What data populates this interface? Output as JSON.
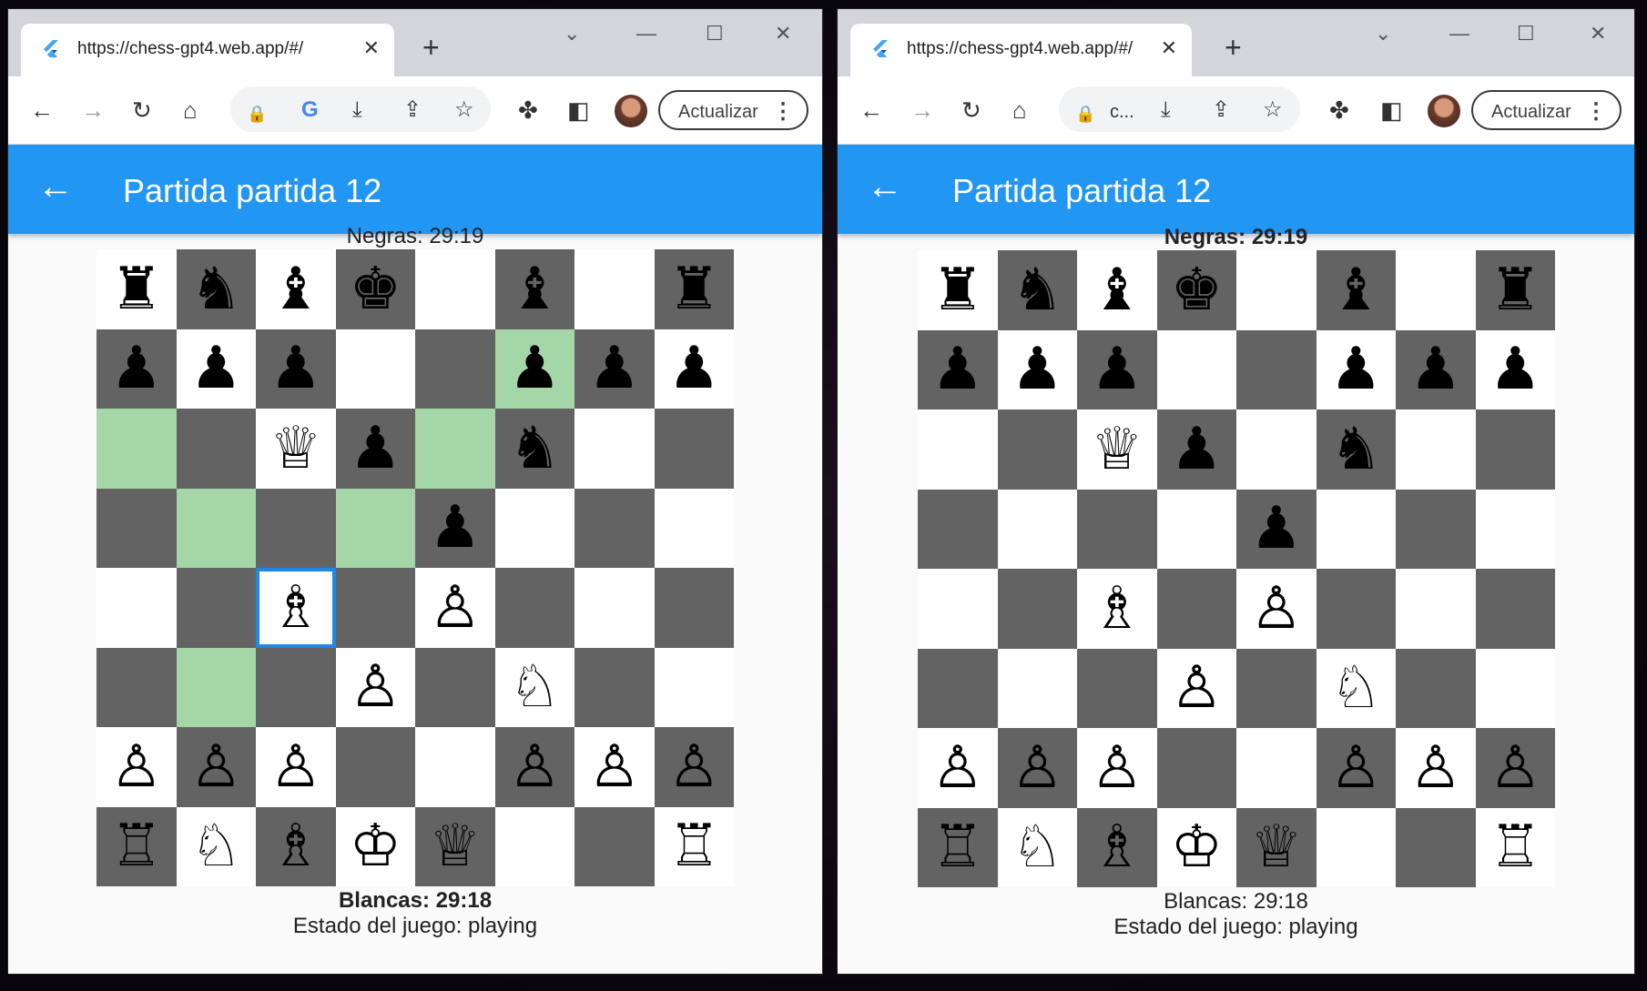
{
  "browser": {
    "tab_title_1": "https://chess-gpt4.web.app/#/",
    "tab_title_2": "https://chess-gpt4.web.app/#/",
    "omnibox_text_2": "c...",
    "update_label": "Actualizar"
  },
  "icons": {
    "back": "←",
    "forward": "→",
    "reload": "↻",
    "home": "⌂",
    "lock": "🔒",
    "close": "✕",
    "newtab": "+",
    "star": "☆",
    "share": "⇪",
    "install": "⤓",
    "extensions": "✤",
    "sidepanel": "◧",
    "menu": "⋮",
    "minimize": "—",
    "maximize": "☐",
    "chevron": "⌄",
    "google": "G"
  },
  "app": {
    "title": "Partida partida 12",
    "back_icon": "←"
  },
  "colors": {
    "appbar": "#2196f3",
    "dark_square": "#636363",
    "light_square": "#ffffff",
    "highlight": "#a5d6a7",
    "selection": "#1e88e5"
  },
  "game_left": {
    "black_clock": "Negras: 29:19",
    "white_clock": "Blancas: 29:18",
    "status": "Estado del juego: playing",
    "active_player": "white",
    "selected_square": [
      4,
      2
    ],
    "highlights": [
      [
        1,
        5
      ],
      [
        2,
        0
      ],
      [
        2,
        4
      ],
      [
        3,
        1
      ],
      [
        3,
        3
      ],
      [
        5,
        1
      ]
    ],
    "board": [
      [
        "♜",
        "♞",
        "♝",
        "♚",
        "",
        "♝",
        "",
        "♜"
      ],
      [
        "♟",
        "♟",
        "♟",
        "",
        "",
        "♟",
        "♟",
        "♟"
      ],
      [
        "",
        "",
        "♕",
        "♟",
        "",
        "♞",
        "",
        ""
      ],
      [
        "",
        "",
        "",
        "",
        "♟",
        "",
        "",
        ""
      ],
      [
        "",
        "",
        "♗",
        "",
        "♙",
        "",
        "",
        ""
      ],
      [
        "",
        "",
        "",
        "♙",
        "",
        "♘",
        "",
        ""
      ],
      [
        "♙",
        "♙",
        "♙",
        "",
        "",
        "♙",
        "♙",
        "♙"
      ],
      [
        "♖",
        "♘",
        "♗",
        "♔",
        "♕",
        "",
        "",
        "♖"
      ]
    ]
  },
  "game_right": {
    "black_clock": "Negras: 29:19",
    "white_clock": "Blancas: 29:18",
    "status": "Estado del juego: playing",
    "active_player": "black",
    "board": [
      [
        "♜",
        "♞",
        "♝",
        "♚",
        "",
        "♝",
        "",
        "♜"
      ],
      [
        "♟",
        "♟",
        "♟",
        "",
        "",
        "♟",
        "♟",
        "♟"
      ],
      [
        "",
        "",
        "♕",
        "♟",
        "",
        "♞",
        "",
        ""
      ],
      [
        "",
        "",
        "",
        "",
        "♟",
        "",
        "",
        ""
      ],
      [
        "",
        "",
        "♗",
        "",
        "♙",
        "",
        "",
        ""
      ],
      [
        "",
        "",
        "",
        "♙",
        "",
        "♘",
        "",
        ""
      ],
      [
        "♙",
        "♙",
        "♙",
        "",
        "",
        "♙",
        "♙",
        "♙"
      ],
      [
        "♖",
        "♘",
        "♗",
        "♔",
        "♕",
        "",
        "",
        "♖"
      ]
    ]
  }
}
